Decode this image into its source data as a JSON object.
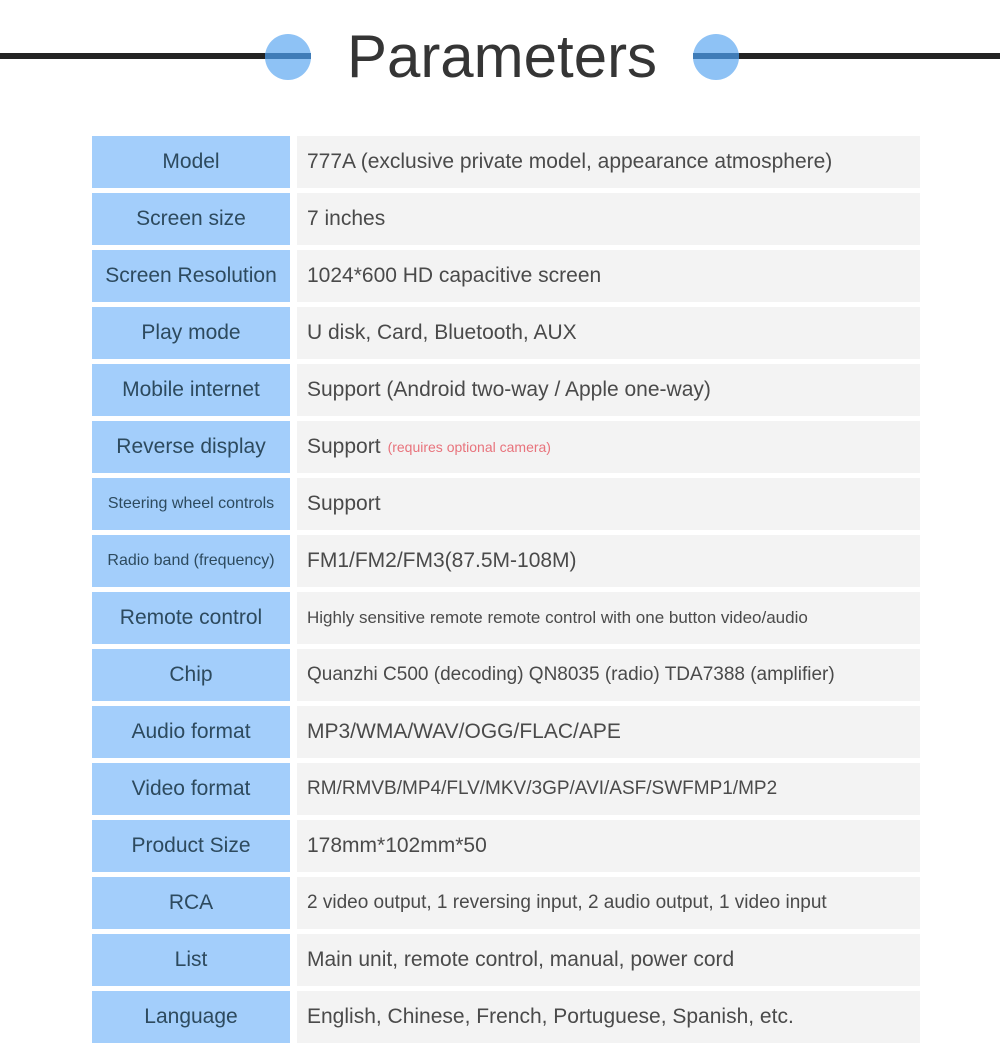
{
  "header": {
    "title": "Parameters",
    "rule_color": "#232323",
    "dot_color": "#8ec2f5",
    "dot_band_color": "#3f7cb8"
  },
  "theme": {
    "label_bg": "#a3cefb",
    "label_text": "#2d4a5e",
    "value_bg": "#f3f3f3",
    "value_text": "#4a4a4a",
    "note_text": "#e8737c"
  },
  "spec_rows": [
    {
      "label": "Model",
      "value": "777A (exclusive private model, appearance atmosphere)"
    },
    {
      "label": "Screen size",
      "value": "7 inches"
    },
    {
      "label": "Screen Resolution",
      "value": "1024*600 HD capacitive screen"
    },
    {
      "label": "Play mode",
      "value": "U disk, Card, Bluetooth, AUX"
    },
    {
      "label": "Mobile internet",
      "value": "Support (Android two-way / Apple one-way)"
    },
    {
      "label": "Reverse display",
      "value": "Support",
      "note": "(requires optional camera)"
    },
    {
      "label": "Steering wheel controls",
      "value": "Support"
    },
    {
      "label": "Radio band (frequency)",
      "value": "FM1/FM2/FM3(87.5M-108M)"
    },
    {
      "label": "Remote control",
      "value": "Highly sensitive remote remote control with one button video/audio"
    },
    {
      "label": "Chip",
      "value": "Quanzhi C500 (decoding) QN8035 (radio) TDA7388 (amplifier)"
    },
    {
      "label": "Audio format",
      "value": "MP3/WMA/WAV/OGG/FLAC/APE"
    },
    {
      "label": "Video format",
      "value": "RM/RMVB/MP4/FLV/MKV/3GP/AVI/ASF/SWFMP1/MP2"
    },
    {
      "label": "Product Size",
      "value": "178mm*102mm*50"
    },
    {
      "label": "RCA",
      "value": "2 video output, 1 reversing input, 2 audio output, 1 video input"
    },
    {
      "label": "List",
      "value": "Main unit, remote control, manual, power cord"
    },
    {
      "label": "Language",
      "value": "English, Chinese, French, Portuguese, Spanish, etc."
    }
  ]
}
